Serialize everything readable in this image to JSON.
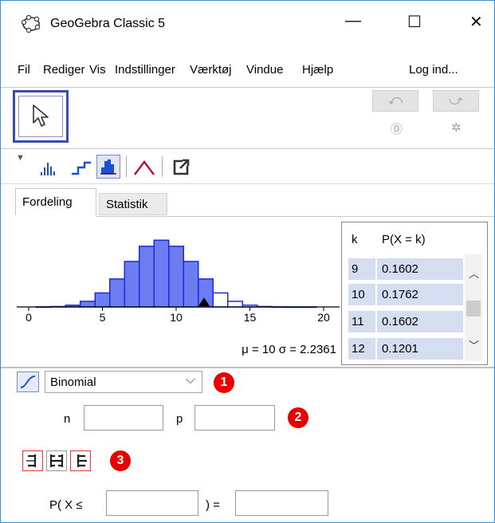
{
  "window": {
    "title": "GeoGebra Classic 5",
    "minimize": "—",
    "maximize": "☐",
    "close": "✕"
  },
  "menu": [
    "Fil",
    "Rediger",
    "Vis",
    "Indstillinger",
    "Værktøj",
    "Vindue",
    "Hjælp"
  ],
  "login": "Log ind...",
  "toolbar": {
    "undo": "⤺",
    "redo": "⤻",
    "help_icon": "help-icon",
    "settings_icon": "gear-icon"
  },
  "tabs": [
    "Fordeling",
    "Statistik"
  ],
  "chart_data": {
    "type": "bar",
    "x_ticks": [
      "0",
      "5",
      "10",
      "15",
      "20"
    ],
    "xlim": [
      0,
      20
    ],
    "ylim": [
      0,
      0.2
    ],
    "categories": [
      1,
      2,
      3,
      4,
      5,
      6,
      7,
      8,
      9,
      10,
      11,
      12,
      13,
      14,
      15,
      16,
      17,
      18,
      19
    ],
    "values": [
      0.0002,
      0.0011,
      0.0046,
      0.0148,
      0.037,
      0.0739,
      0.1201,
      0.1602,
      0.1762,
      0.1602,
      0.1201,
      0.0739,
      0.037,
      0.0148,
      0.0046,
      0.0011,
      0.0002,
      0.0,
      0.0
    ],
    "highlighted_max_x": 12,
    "marker_x": 12,
    "fill_color": "#6b7df0",
    "stroke_color": "#1a2bd6",
    "stats": "μ = 10   σ = 2.2361"
  },
  "table": {
    "headers": [
      "k",
      "P(X = k)"
    ],
    "rows": [
      {
        "k": "9",
        "p": "0.1602"
      },
      {
        "k": "10",
        "p": "0.1762"
      },
      {
        "k": "11",
        "p": "0.1602"
      },
      {
        "k": "12",
        "p": "0.1201"
      }
    ]
  },
  "distribution": {
    "selected": "Binomial",
    "badge1": "1",
    "badge2": "2",
    "badge3": "3",
    "n_label": "n",
    "p_label": "p",
    "n_value": "",
    "p_value": ""
  },
  "probability": {
    "prefix": "P( X ≤",
    "suffix": ") =",
    "bound_value": "",
    "result_value": ""
  },
  "colors": {
    "accent": "#3b4da8",
    "badge": "#e60000",
    "table_cell": "#d5def0"
  }
}
